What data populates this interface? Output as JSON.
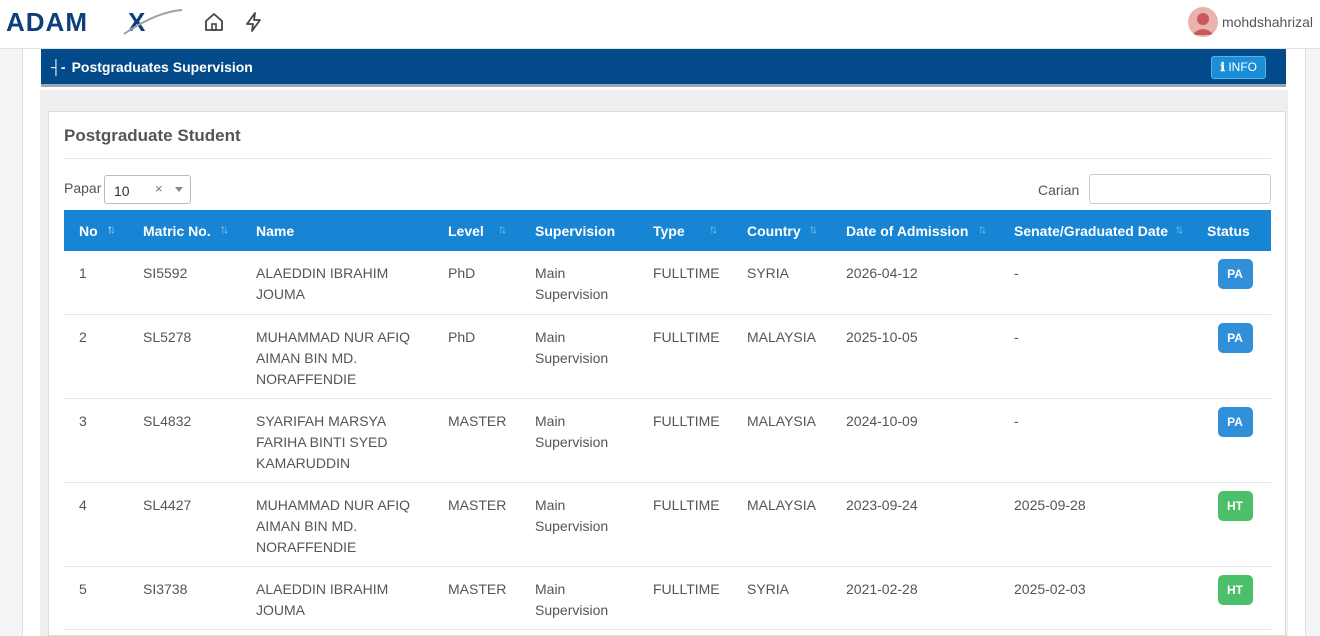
{
  "brand": "ADAMX",
  "user": {
    "name": "mohdshahrizal"
  },
  "section": {
    "title": "Postgraduates Supervision",
    "collapse_glyph": "┤-",
    "info_label": "INFO"
  },
  "card": {
    "title": "Postgraduate Student"
  },
  "controls": {
    "show_label": "Papar",
    "show_value": "10",
    "clear_glyph": "×",
    "search_label": "Carian",
    "search_value": ""
  },
  "table": {
    "headers": [
      "No",
      "Matric No.",
      "Name",
      "Level",
      "Supervision",
      "Type",
      "Country",
      "Date of Admission",
      "Senate/Graduated Date",
      "Status"
    ],
    "rows": [
      {
        "no": "1",
        "matric": "SI5592",
        "name": [
          "ALAEDDIN IBRAHIM",
          "JOUMA"
        ],
        "level": "PhD",
        "supervision": [
          "Main",
          "Supervision"
        ],
        "type": "FULLTIME",
        "country": "SYRIA",
        "admission": "2026-04-12",
        "senate": "-",
        "status": "PA"
      },
      {
        "no": "2",
        "matric": "SL5278",
        "name": [
          "MUHAMMAD NUR AFIQ",
          "AIMAN BIN MD.",
          "NORAFFENDIE"
        ],
        "level": "PhD",
        "supervision": [
          "Main",
          "Supervision"
        ],
        "type": "FULLTIME",
        "country": "MALAYSIA",
        "admission": "2025-10-05",
        "senate": "-",
        "status": "PA"
      },
      {
        "no": "3",
        "matric": "SL4832",
        "name": [
          "SYARIFAH MARSYA",
          "FARIHA BINTI SYED",
          "KAMARUDDIN"
        ],
        "level": "MASTER",
        "supervision": [
          "Main",
          "Supervision"
        ],
        "type": "FULLTIME",
        "country": "MALAYSIA",
        "admission": "2024-10-09",
        "senate": "-",
        "status": "PA"
      },
      {
        "no": "4",
        "matric": "SL4427",
        "name": [
          "MUHAMMAD NUR AFIQ",
          "AIMAN BIN MD.",
          "NORAFFENDIE"
        ],
        "level": "MASTER",
        "supervision": [
          "Main",
          "Supervision"
        ],
        "type": "FULLTIME",
        "country": "MALAYSIA",
        "admission": "2023-09-24",
        "senate": "2025-09-28",
        "status": "HT"
      },
      {
        "no": "5",
        "matric": "SI3738",
        "name": [
          "ALAEDDIN IBRAHIM",
          "JOUMA"
        ],
        "level": "MASTER",
        "supervision": [
          "Main",
          "Supervision"
        ],
        "type": "FULLTIME",
        "country": "SYRIA",
        "admission": "2021-02-28",
        "senate": "2025-02-03",
        "status": "HT"
      }
    ]
  },
  "colors": {
    "header_bar": "#034a8a",
    "table_header": "#1785d3",
    "badge_pa": "#2f8fd8",
    "badge_ht": "#4cbf6a",
    "info_button": "#1a8fd8"
  }
}
